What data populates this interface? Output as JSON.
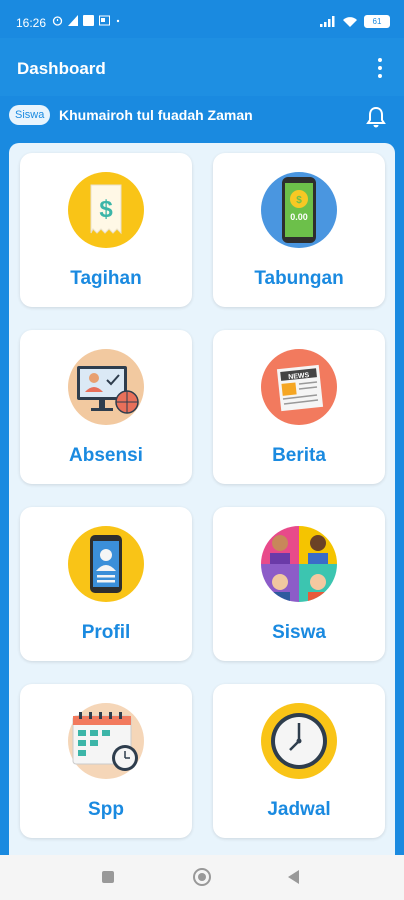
{
  "status": {
    "time": "16:26",
    "battery": "61"
  },
  "appbar": {
    "title": "Dashboard"
  },
  "user": {
    "badge": "Siswa",
    "name": "Khumairoh tul fuadah Zaman"
  },
  "menu": [
    {
      "label": "Tagihan",
      "icon": "bill-icon"
    },
    {
      "label": "Tabungan",
      "icon": "savings-phone-icon"
    },
    {
      "label": "Absensi",
      "icon": "attendance-icon"
    },
    {
      "label": "Berita",
      "icon": "news-icon"
    },
    {
      "label": "Profil",
      "icon": "profile-icon"
    },
    {
      "label": "Siswa",
      "icon": "students-icon"
    },
    {
      "label": "Spp",
      "icon": "calendar-icon"
    },
    {
      "label": "Jadwal",
      "icon": "clock-icon"
    }
  ],
  "colors": {
    "primary": "#1a8ae0",
    "panel": "#e8f4fc"
  }
}
